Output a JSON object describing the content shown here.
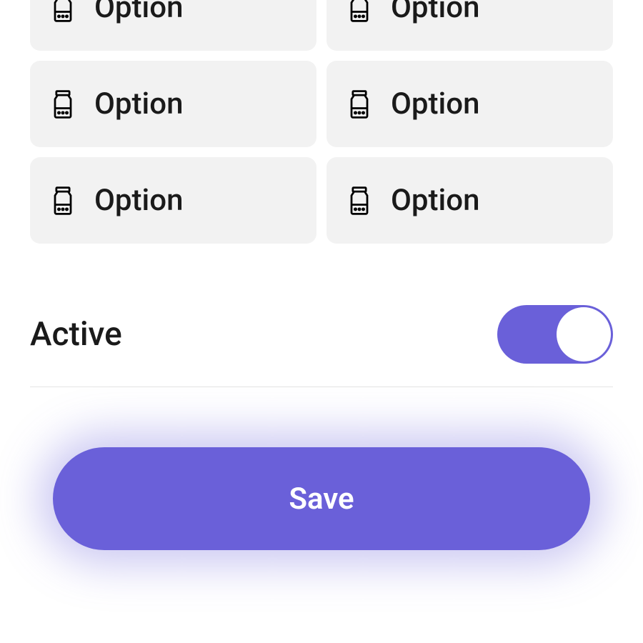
{
  "options": [
    {
      "label": "Option"
    },
    {
      "label": "Option"
    },
    {
      "label": "Option"
    },
    {
      "label": "Option"
    },
    {
      "label": "Option"
    },
    {
      "label": "Option"
    }
  ],
  "active": {
    "label": "Active",
    "on": true
  },
  "save": {
    "label": "Save"
  },
  "colors": {
    "accent": "#6a60d9",
    "card_bg": "#f2f2f2"
  }
}
